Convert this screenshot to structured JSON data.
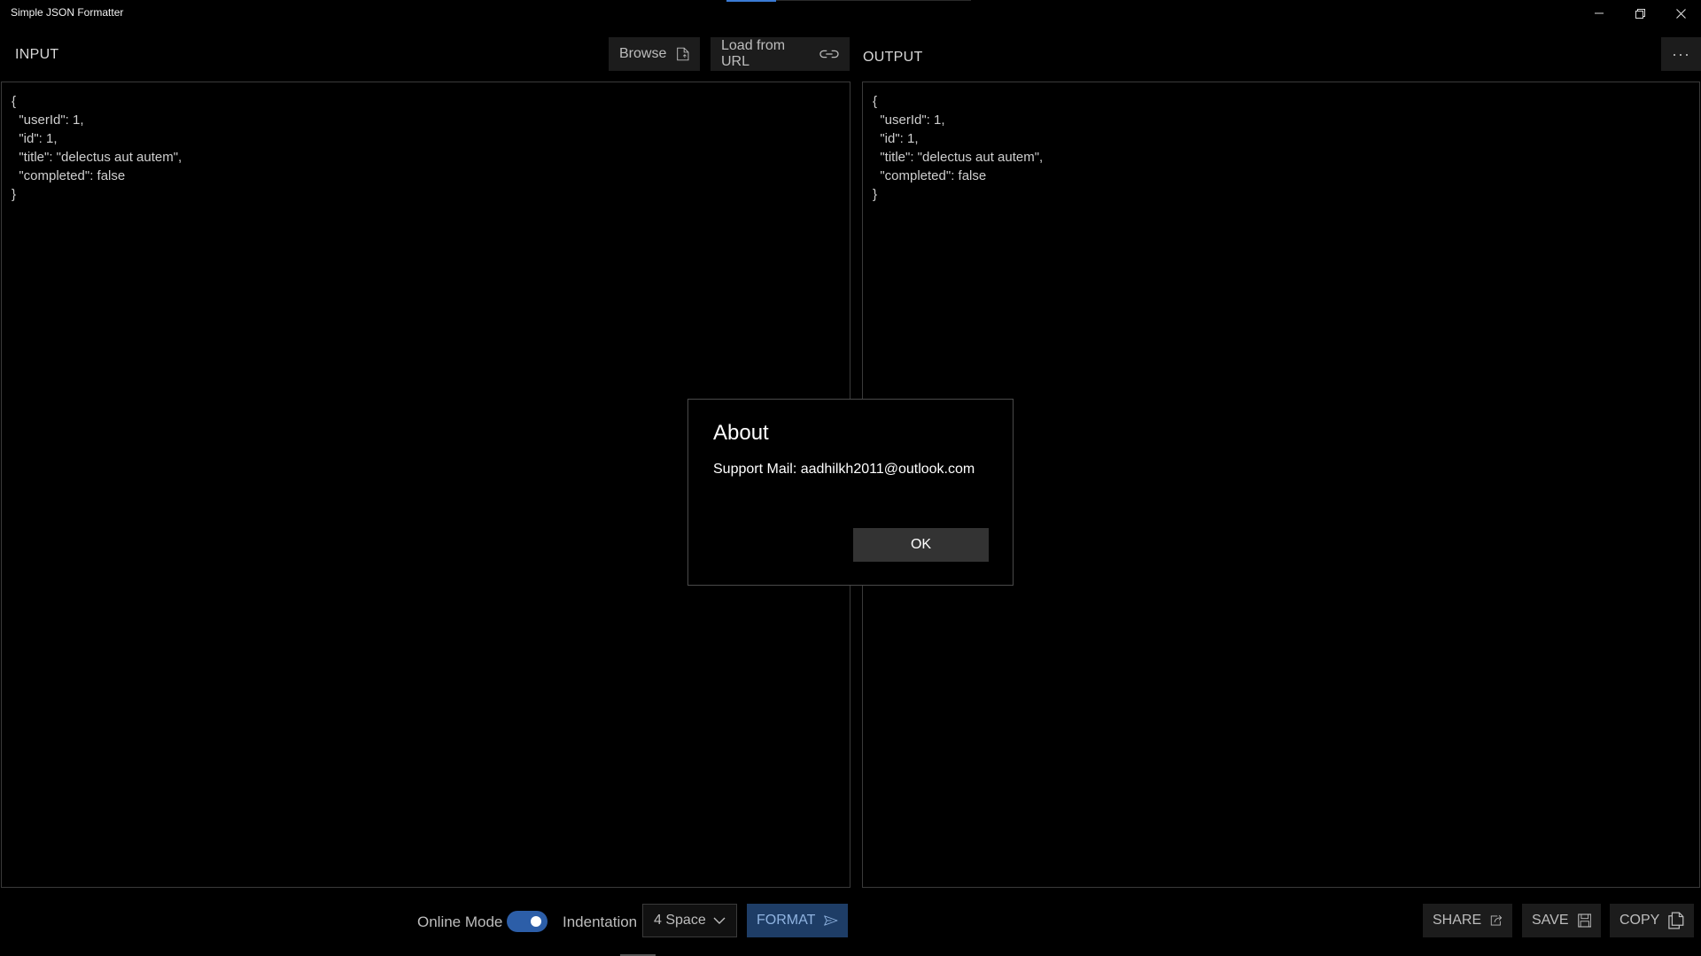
{
  "window": {
    "title": "Simple JSON Formatter"
  },
  "input": {
    "label": "INPUT",
    "browse_label": "Browse",
    "load_url_label": "Load from URL",
    "content": "{\n  \"userId\": 1,\n  \"id\": 1,\n  \"title\": \"delectus aut autem\",\n  \"completed\": false\n}"
  },
  "output": {
    "label": "OUTPUT",
    "more_label": "···",
    "content": "{\n  \"userId\": 1,\n  \"id\": 1,\n  \"title\": \"delectus aut autem\",\n  \"completed\": false\n}"
  },
  "dialog": {
    "title": "About",
    "message": "Support Mail: aadhilkh2011@outlook.com",
    "ok_label": "OK"
  },
  "bottom": {
    "online_mode_label": "Online Mode",
    "online_mode_on": true,
    "indentation_label": "Indentation",
    "indentation_value": "4 Space",
    "format_label": "FORMAT",
    "share_label": "SHARE",
    "save_label": "SAVE",
    "copy_label": "COPY"
  },
  "colors": {
    "accent": "#2c5ea8",
    "format_button": "#1e3d66",
    "background": "#000000"
  },
  "icons": {
    "browse": "file-icon",
    "load_url": "link-icon",
    "format": "send-icon",
    "share": "share-icon",
    "save": "save-icon",
    "copy": "copy-icon"
  }
}
